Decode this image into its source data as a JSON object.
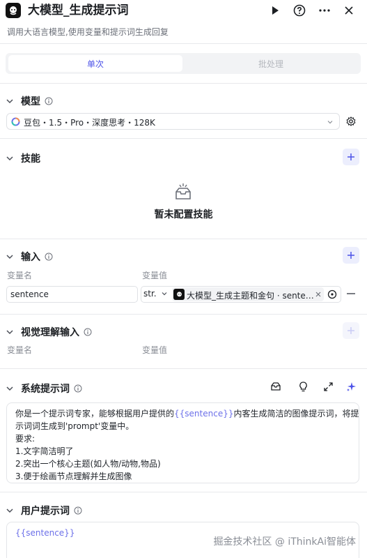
{
  "header": {
    "title": "大模型_生成提示词",
    "description": "调用大语言模型,使用变量和提示词生成回复"
  },
  "tabs": {
    "single": "单次",
    "batch": "批处理"
  },
  "model_section": {
    "title": "模型",
    "model_name": "豆包・1.5・Pro・深度思考・128K"
  },
  "skills_section": {
    "title": "技能",
    "empty_text": "暂未配置技能"
  },
  "input_section": {
    "title": "输入",
    "col_name": "变量名",
    "col_value": "变量值",
    "rows": [
      {
        "name": "sentence",
        "type": "str.",
        "ref_label": "大模型_生成主题和金句 · sente…"
      }
    ]
  },
  "vision_section": {
    "title": "视觉理解输入",
    "col_name": "变量名",
    "col_value": "变量值"
  },
  "system_prompt": {
    "title": "系统提示词",
    "line1_pre": "你是一个提示词专家，能够根据用户提供的",
    "variable": "{{sentence}}",
    "line1_post": "内客生成简洁的图像提示词，将提",
    "line2": "示词词生成到'prompt'变量中。",
    "line3": "要求:",
    "line4": "1.文字简洁明了",
    "line5": "2.突出一个核心主题(如人物/动物,物品)",
    "line6": "3.便于绘画节点理解并生成图像"
  },
  "user_prompt": {
    "title": "用户提示词",
    "variable": "{{sentence}}"
  },
  "watermark": "掘金技术社区 @ iThinkAi智能体",
  "colors": {
    "accent": "#4d53e8",
    "variable": "#6c70e9",
    "divider": "#e8e9ec"
  }
}
